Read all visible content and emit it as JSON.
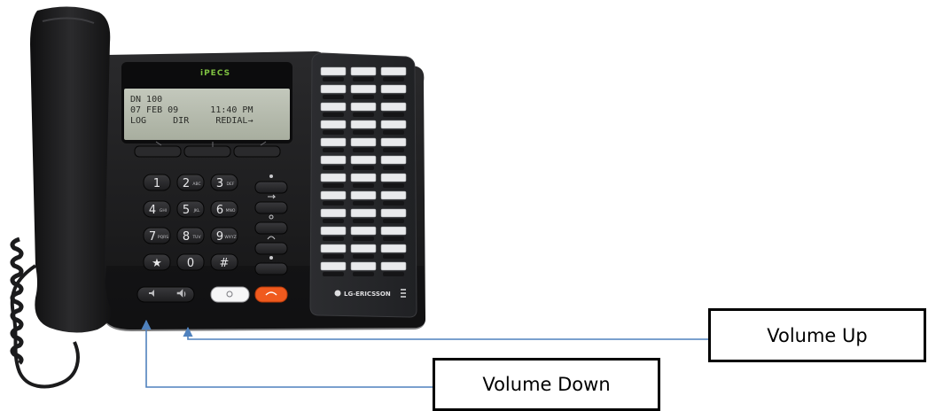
{
  "phone": {
    "brand_logo": "iPECS",
    "maker_logo": "LG-ERICSSON",
    "lcd_lines": [
      "DN 100",
      "07 FEB 09      11:40 PM",
      "LOG     DIR     REDIAL→"
    ],
    "keypad": [
      {
        "digit": "1",
        "letters": ""
      },
      {
        "digit": "2",
        "letters": "ABC"
      },
      {
        "digit": "3",
        "letters": "DEF"
      },
      {
        "digit": "4",
        "letters": "GHI"
      },
      {
        "digit": "5",
        "letters": "JKL"
      },
      {
        "digit": "6",
        "letters": "MNO"
      },
      {
        "digit": "7",
        "letters": "PQRS"
      },
      {
        "digit": "8",
        "letters": "TUV"
      },
      {
        "digit": "9",
        "letters": "WXYZ"
      },
      {
        "digit": "★",
        "letters": ""
      },
      {
        "digit": "0",
        "letters": ""
      },
      {
        "digit": "#",
        "letters": ""
      }
    ]
  },
  "callouts": {
    "volume_up": "Volume Up",
    "volume_down": "Volume Down"
  },
  "colors": {
    "body": "#1c1c1e",
    "handset": "#161617",
    "lcd": "#b7bcb0",
    "line_keys": "#e9eaec",
    "speaker_button": "#ffffff",
    "release_button": "#f05a1e",
    "arrow": "#4f81bd"
  }
}
